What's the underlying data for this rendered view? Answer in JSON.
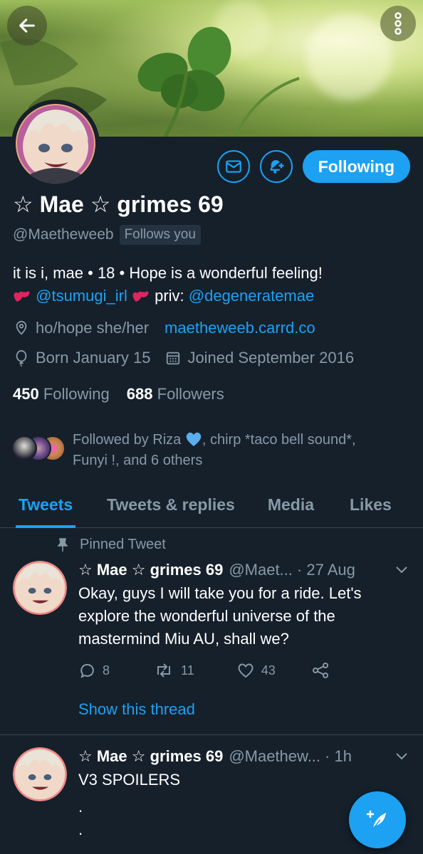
{
  "header": {
    "back_icon": "arrow-left-icon",
    "more_icon": "more-vertical-icon"
  },
  "profile": {
    "display_name": "☆ Mae ☆ grimes 69",
    "handle": "@Maetheweeb",
    "follows_you": "Follows you",
    "bio_line1": "it is i, mae • 18 • Hope is a wonderful feeling!",
    "bio_mention1": "@tsumugi_irl",
    "bio_priv": "priv:",
    "bio_mention2": "@degeneratemae",
    "location": "ho/hope she/her",
    "website": "maetheweeb.carrd.co",
    "born": "Born January 15",
    "joined": "Joined September 2016",
    "following_count": "450",
    "following_label": "Following",
    "followers_count": "688",
    "followers_label": "Followers",
    "followed_by_prefix": "Followed by Riza",
    "followed_by_rest": ", chirp *taco bell sound*,",
    "followed_by_line2": "Funyi !, and 6 others"
  },
  "actions": {
    "follow_label": "Following",
    "message_icon": "envelope-icon",
    "notify_icon": "bell-plus-icon"
  },
  "tabs": [
    {
      "label": "Tweets",
      "active": true
    },
    {
      "label": "Tweets & replies",
      "active": false
    },
    {
      "label": "Media",
      "active": false
    },
    {
      "label": "Likes",
      "active": false
    }
  ],
  "tweets": [
    {
      "pinned_label": "Pinned Tweet",
      "name": "☆ Mae ☆ grimes 69",
      "handle": "@Maet...",
      "time": "· 27 Aug",
      "text": "Okay, guys I will take you for a ride. Let's explore the wonderful universe of the mastermind Miu AU, shall we?",
      "replies": "8",
      "retweets": "11",
      "likes": "43",
      "show_thread": "Show this thread"
    },
    {
      "name": "☆ Mae ☆ grimes 69",
      "handle": "@Maethew...",
      "time": "· 1h",
      "text": "V3 SPOILERS",
      "extra1": ".",
      "extra2": "."
    }
  ],
  "colors": {
    "accent": "#1da1f2",
    "background": "#15202b",
    "muted": "#8899a6",
    "heart_emoji": "#e0245e"
  }
}
